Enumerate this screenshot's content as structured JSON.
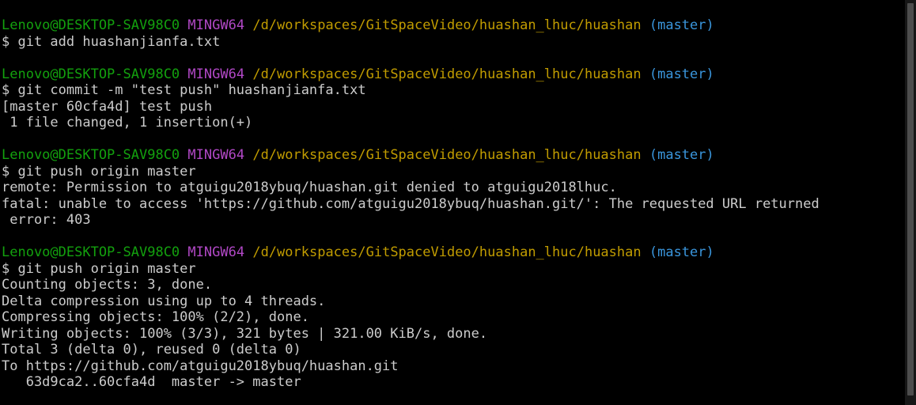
{
  "colors": {
    "background": "#000000",
    "user_host": "#13a10e",
    "system": "#b148c6",
    "path": "#c19c00",
    "branch": "#3a96dd",
    "output": "#cccccc"
  },
  "prompt": {
    "user_host": "Lenovo@DESKTOP-SAV98C0",
    "system": "MINGW64",
    "path": "/d/workspaces/GitSpaceVideo/huashan_lhuc/huashan",
    "branch": "(master)"
  },
  "blocks": [
    {
      "command": "$ git add huashanjianfa.txt",
      "output": []
    },
    {
      "command": "$ git commit -m \"test push\" huashanjianfa.txt",
      "output": [
        "[master 60cfa4d] test push",
        " 1 file changed, 1 insertion(+)"
      ]
    },
    {
      "command": "$ git push origin master",
      "output": [
        "remote: Permission to atguigu2018ybuq/huashan.git denied to atguigu2018lhuc.",
        "fatal: unable to access 'https://github.com/atguigu2018ybuq/huashan.git/': The requested URL returned",
        " error: 403"
      ]
    },
    {
      "command": "$ git push origin master",
      "output": [
        "Counting objects: 3, done.",
        "Delta compression using up to 4 threads.",
        "Compressing objects: 100% (2/2), done.",
        "Writing objects: 100% (3/3), 321 bytes | 321.00 KiB/s, done.",
        "Total 3 (delta 0), reused 0 (delta 0)",
        "To https://github.com/atguigu2018ybuq/huashan.git",
        "   63d9ca2..60cfa4d  master -> master"
      ]
    }
  ]
}
